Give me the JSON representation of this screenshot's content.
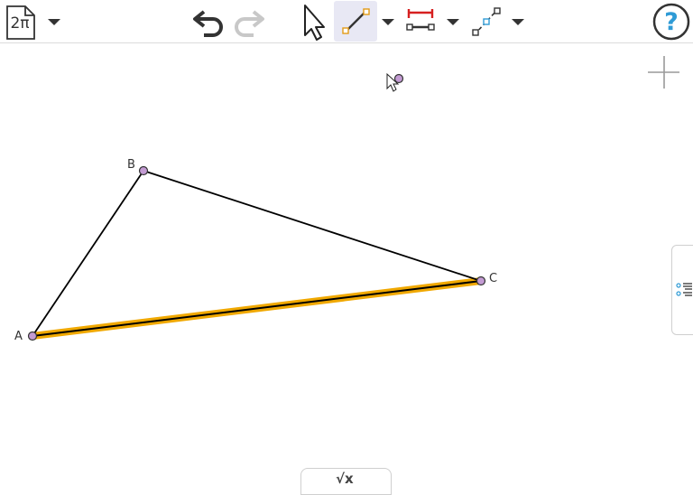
{
  "toolbar": {
    "file_menu_label": "2π",
    "icons": [
      "file-menu-icon",
      "dropdown-icon",
      "undo-icon",
      "redo-icon",
      "move-arrow-icon",
      "segment-tool-icon",
      "distance-tool-icon",
      "line-tool-icon",
      "help-icon"
    ]
  },
  "colors": {
    "point_fill": "#c39bd3",
    "highlight": "#f0a800",
    "segment": "#000000",
    "active_tool_bg": "#e8e8f4",
    "help_blue": "#2f9bd6"
  },
  "canvas": {
    "points": [
      {
        "id": "A",
        "label": "A"
      },
      {
        "id": "B",
        "label": "B"
      },
      {
        "id": "C",
        "label": "C"
      }
    ],
    "segments": [
      {
        "from": "A",
        "to": "B",
        "selected": false
      },
      {
        "from": "B",
        "to": "C",
        "selected": false
      },
      {
        "from": "A",
        "to": "C",
        "selected": true
      }
    ]
  },
  "bottom_tab": {
    "label": "√x"
  }
}
